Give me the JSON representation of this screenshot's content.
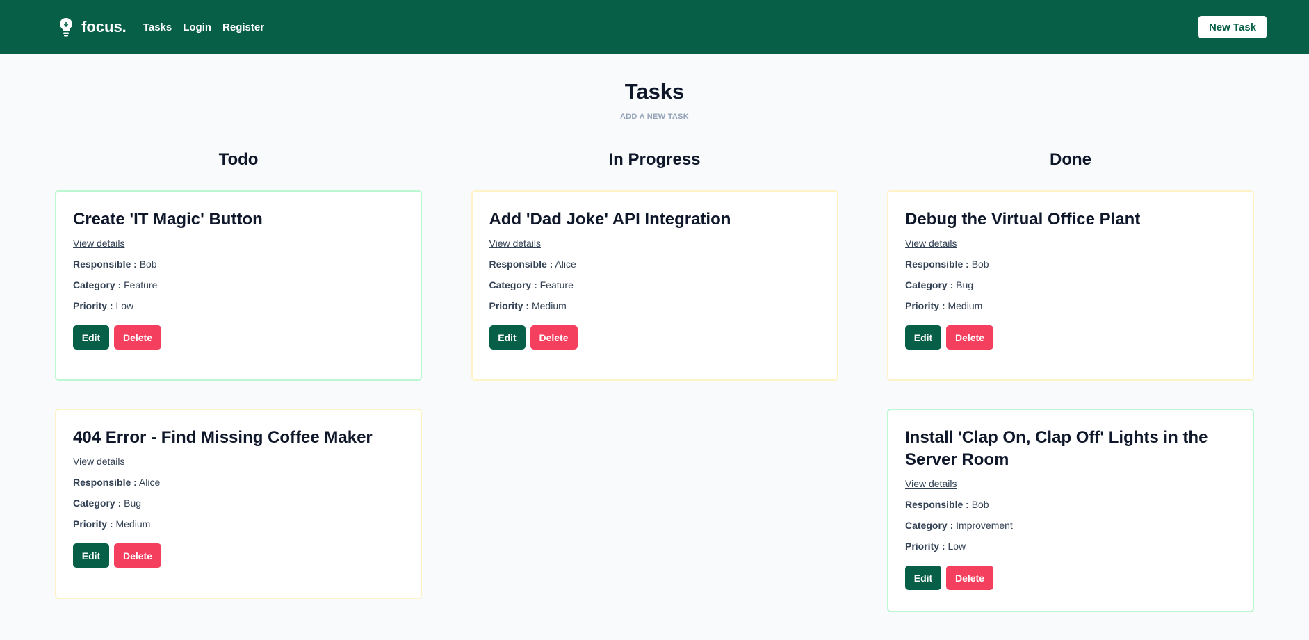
{
  "nav": {
    "brand": "focus.",
    "links": [
      "Tasks",
      "Login",
      "Register"
    ],
    "new_task": "New Task"
  },
  "header": {
    "title": "Tasks",
    "subtitle": "ADD A NEW TASK"
  },
  "labels": {
    "view_details": "View details",
    "responsible": "Responsible :",
    "category": "Category :",
    "priority": "Priority :",
    "edit": "Edit",
    "delete": "Delete"
  },
  "columns": [
    {
      "title": "Todo",
      "cards": [
        {
          "title": "Create 'IT Magic' Button",
          "responsible": "Bob",
          "category": "Feature",
          "priority": "Low",
          "border": "green"
        },
        {
          "title": "404 Error - Find Missing Coffee Maker",
          "responsible": "Alice",
          "category": "Bug",
          "priority": "Medium",
          "border": "amber"
        }
      ]
    },
    {
      "title": "In Progress",
      "cards": [
        {
          "title": "Add 'Dad Joke' API Integration",
          "responsible": "Alice",
          "category": "Feature",
          "priority": "Medium",
          "border": "amber"
        }
      ]
    },
    {
      "title": "Done",
      "cards": [
        {
          "title": "Debug the Virtual Office Plant",
          "responsible": "Bob",
          "category": "Bug",
          "priority": "Medium",
          "border": "amber"
        },
        {
          "title": "Install 'Clap On, Clap Off' Lights in the Server Room",
          "responsible": "Bob",
          "category": "Improvement",
          "priority": "Low",
          "border": "green"
        }
      ]
    }
  ],
  "colors": {
    "brand": "#065f46",
    "delete": "#f43f5e",
    "border_low": "#bbf7d0",
    "border_medium": "#fef3c7",
    "background": "#f8fafc"
  },
  "icons": {
    "logo": "lightbulb-icon"
  }
}
